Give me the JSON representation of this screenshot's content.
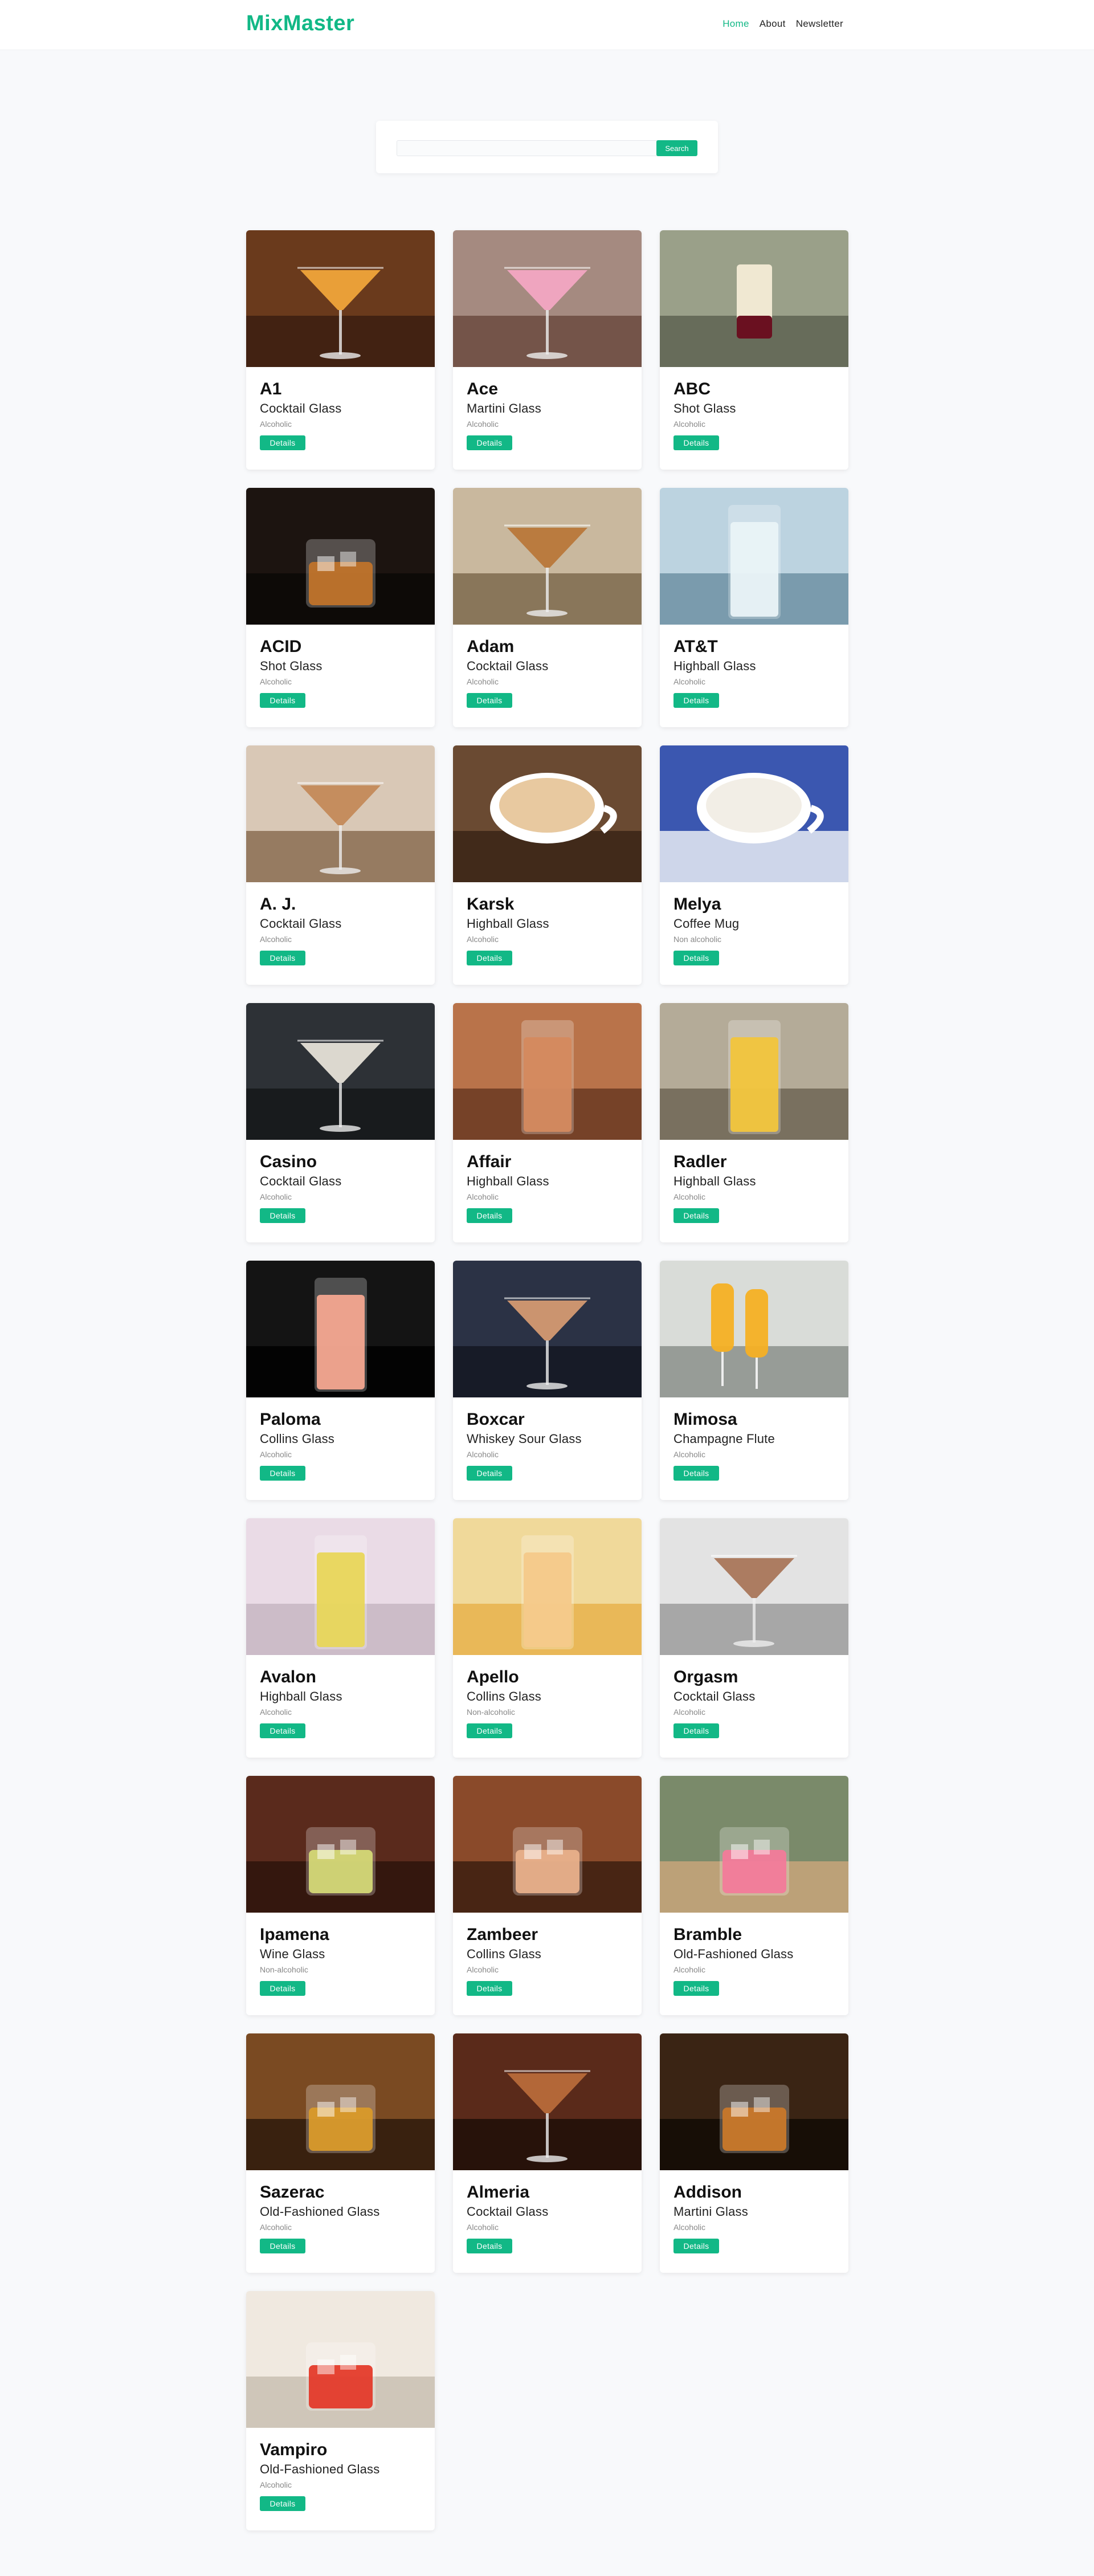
{
  "brand": "MixMaster",
  "nav": [
    {
      "label": "Home",
      "active": true
    },
    {
      "label": "About",
      "active": false
    },
    {
      "label": "Newsletter",
      "active": false
    }
  ],
  "search": {
    "value": "",
    "placeholder": "",
    "button_label": "Search"
  },
  "details_label": "Details",
  "colors": {
    "accent": "#12b886",
    "background": "#f8f9fb"
  },
  "cocktails": [
    {
      "name": "A1",
      "glass": "Cocktail Glass",
      "alcoholic": "Alcoholic",
      "image": "orange-martini-photo"
    },
    {
      "name": "Ace",
      "glass": "Martini Glass",
      "alcoholic": "Alcoholic",
      "image": "pink-martini-photo"
    },
    {
      "name": "ABC",
      "glass": "Shot Glass",
      "alcoholic": "Alcoholic",
      "image": "layered-shot-photo"
    },
    {
      "name": "ACID",
      "glass": "Shot Glass",
      "alcoholic": "Alcoholic",
      "image": "whiskey-rocks-photo"
    },
    {
      "name": "Adam",
      "glass": "Cocktail Glass",
      "alcoholic": "Alcoholic",
      "image": "lime-martini-photo"
    },
    {
      "name": "AT&T",
      "glass": "Highball Glass",
      "alcoholic": "Alcoholic",
      "image": "clear-highball-photo"
    },
    {
      "name": "A. J.",
      "glass": "Cocktail Glass",
      "alcoholic": "Alcoholic",
      "image": "grapefruit-martini-photo"
    },
    {
      "name": "Karsk",
      "glass": "Highball Glass",
      "alcoholic": "Alcoholic",
      "image": "coffee-cup-photo"
    },
    {
      "name": "Melya",
      "glass": "Coffee Mug",
      "alcoholic": "Non alcoholic",
      "image": "cappuccino-photo"
    },
    {
      "name": "Casino",
      "glass": "Cocktail Glass",
      "alcoholic": "Alcoholic",
      "image": "cherry-coupe-photo"
    },
    {
      "name": "Affair",
      "glass": "Highball Glass",
      "alcoholic": "Alcoholic",
      "image": "peach-pitcher-photo"
    },
    {
      "name": "Radler",
      "glass": "Highball Glass",
      "alcoholic": "Alcoholic",
      "image": "beer-glass-photo"
    },
    {
      "name": "Paloma",
      "glass": "Collins Glass",
      "alcoholic": "Alcoholic",
      "image": "paloma-photo"
    },
    {
      "name": "Boxcar",
      "glass": "Whiskey Sour Glass",
      "alcoholic": "Alcoholic",
      "image": "boxcar-photo"
    },
    {
      "name": "Mimosa",
      "glass": "Champagne Flute",
      "alcoholic": "Alcoholic",
      "image": "mimosa-photo"
    },
    {
      "name": "Avalon",
      "glass": "Highball Glass",
      "alcoholic": "Alcoholic",
      "image": "cucumber-highball-photo"
    },
    {
      "name": "Apello",
      "glass": "Collins Glass",
      "alcoholic": "Non-alcoholic",
      "image": "juice-glass-photo"
    },
    {
      "name": "Orgasm",
      "glass": "Cocktail Glass",
      "alcoholic": "Alcoholic",
      "image": "brown-martini-photo"
    },
    {
      "name": "Ipamena",
      "glass": "Wine Glass",
      "alcoholic": "Non-alcoholic",
      "image": "mint-lime-photo"
    },
    {
      "name": "Zambeer",
      "glass": "Collins Glass",
      "alcoholic": "Alcoholic",
      "image": "iced-jar-photo"
    },
    {
      "name": "Bramble",
      "glass": "Old-Fashioned Glass",
      "alcoholic": "Alcoholic",
      "image": "blackberry-photo"
    },
    {
      "name": "Sazerac",
      "glass": "Old-Fashioned Glass",
      "alcoholic": "Alcoholic",
      "image": "lemon-twist-photo"
    },
    {
      "name": "Almeria",
      "glass": "Cocktail Glass",
      "alcoholic": "Alcoholic",
      "image": "bar-martinis-photo"
    },
    {
      "name": "Addison",
      "glass": "Martini Glass",
      "alcoholic": "Alcoholic",
      "image": "pouring-photo"
    },
    {
      "name": "Vampiro",
      "glass": "Old-Fashioned Glass",
      "alcoholic": "Alcoholic",
      "image": "red-jar-photo"
    }
  ]
}
